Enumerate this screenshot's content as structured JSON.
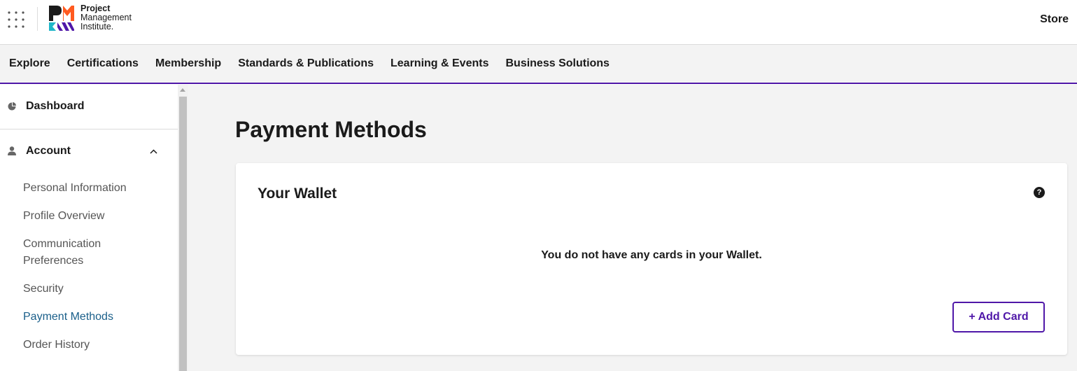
{
  "header": {
    "logo_lines": [
      "Project",
      "Management",
      "Institute."
    ],
    "store_label": "Store"
  },
  "nav": {
    "items": [
      "Explore",
      "Certifications",
      "Membership",
      "Standards & Publications",
      "Learning & Events",
      "Business Solutions"
    ]
  },
  "sidebar": {
    "dashboard_label": "Dashboard",
    "account_label": "Account",
    "items": [
      {
        "label": "Personal Information"
      },
      {
        "label": "Profile Overview"
      },
      {
        "label": "Communication Preferences"
      },
      {
        "label": "Security"
      },
      {
        "label": "Payment Methods",
        "active": true
      },
      {
        "label": "Order History"
      }
    ]
  },
  "main": {
    "page_title": "Payment Methods",
    "wallet": {
      "title": "Your Wallet",
      "help_icon": "?",
      "empty_message": "You do not have any cards in your Wallet.",
      "add_card_label": "+ Add Card"
    }
  },
  "colors": {
    "accent": "#4f17a8",
    "active_link": "#1a5f8a",
    "page_bg": "#f3f3f3"
  },
  "icons": [
    "apps-grid-icon",
    "pmi-logo",
    "dashboard-pie-icon",
    "person-icon",
    "chevron-up-icon",
    "help-circle-icon"
  ]
}
